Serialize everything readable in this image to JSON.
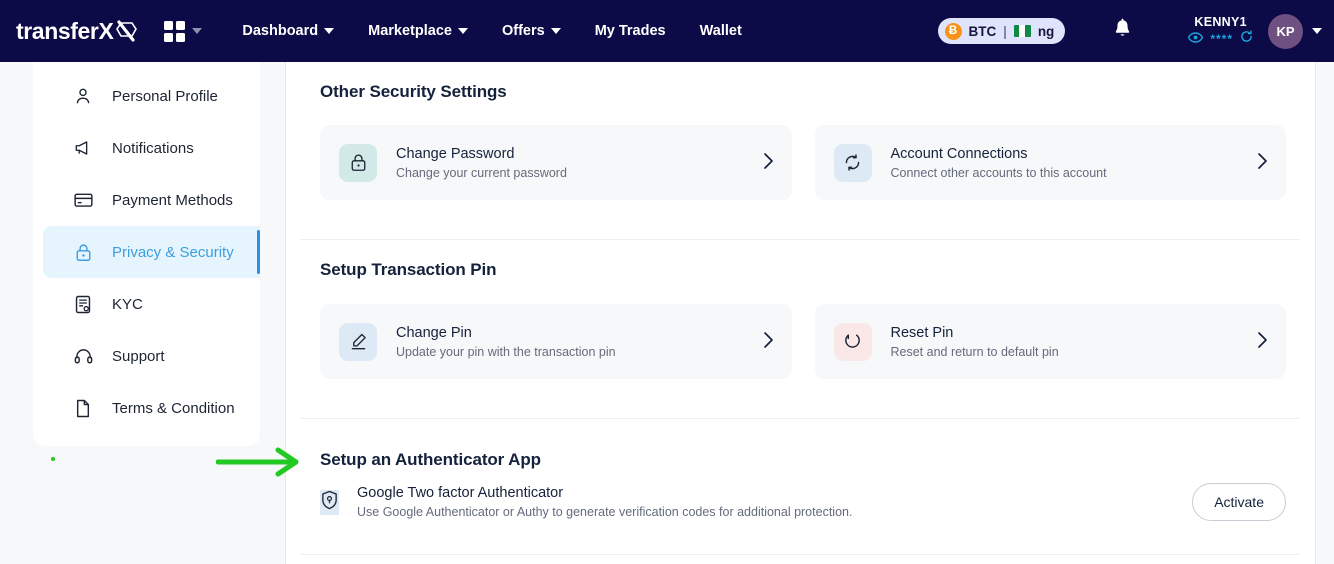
{
  "header": {
    "brand": "transferX",
    "brand_mark": "x-hex-logo",
    "apps_icon": "grid-apps-icon",
    "apps_caret": "chevron-down-icon",
    "nav": [
      {
        "label": "Dashboard",
        "has_caret": true
      },
      {
        "label": "Marketplace",
        "has_caret": true
      },
      {
        "label": "Offers",
        "has_caret": true
      },
      {
        "label": "My Trades",
        "has_caret": false
      },
      {
        "label": "Wallet",
        "has_caret": false
      }
    ],
    "currency_pill": {
      "crypto_symbol": "Ƀ",
      "crypto": "BTC",
      "divider": "|",
      "country": "ng",
      "flag": "nigeria-flag-icon"
    },
    "bell_icon": "notification-bell-icon",
    "user": {
      "name": "KENNY1",
      "eye_icon": "eye-visibility-icon",
      "balance_masked": "****",
      "refresh_icon": "refresh-icon",
      "avatar_initials": "KP",
      "avatar_caret": "chevron-down-icon"
    },
    "colors": {
      "bg": "#0c0a47",
      "pill_bg": "#dfe3fb",
      "btc_orange": "#f7931a",
      "avatar": "#6e5180",
      "accent_cyan": "#1ba7dd"
    }
  },
  "sidebar": {
    "items": [
      {
        "label": "Personal Profile",
        "icon": "user-icon",
        "active": false
      },
      {
        "label": "Notifications",
        "icon": "megaphone-icon",
        "active": false
      },
      {
        "label": "Payment Methods",
        "icon": "credit-card-icon",
        "active": false
      },
      {
        "label": "Privacy & Security",
        "icon": "lock-icon",
        "active": true
      },
      {
        "label": "KYC",
        "icon": "document-id-icon",
        "active": false
      },
      {
        "label": "Support",
        "icon": "headset-icon",
        "active": false
      },
      {
        "label": "Terms & Condition",
        "icon": "file-icon",
        "active": false
      }
    ],
    "active_color": "#3d9fe0",
    "active_bg": "#e6f4fd"
  },
  "main": {
    "security": {
      "title": "Other Security Settings",
      "cards": [
        {
          "title": "Change Password",
          "subtitle": "Change your current password",
          "icon": "padlock-icon",
          "icon_bg": "#d3e9e7",
          "chevron": "chevron-right-icon"
        },
        {
          "title": "Account Connections",
          "subtitle": "Connect other accounts to this account",
          "icon": "sync-circular-arrows-icon",
          "icon_bg": "#dde9f4",
          "chevron": "chevron-right-icon"
        }
      ]
    },
    "pin": {
      "title": "Setup Transaction Pin",
      "cards": [
        {
          "title": "Change Pin",
          "subtitle": "Update your pin with the transaction pin",
          "icon": "pencil-edit-icon",
          "icon_bg": "#dde9f4",
          "chevron": "chevron-right-icon"
        },
        {
          "title": "Reset Pin",
          "subtitle": "Reset and return to default pin",
          "icon": "reset-undo-arrow-icon",
          "icon_bg": "#fae8e8",
          "chevron": "chevron-right-icon"
        }
      ]
    },
    "authenticator": {
      "title": "Setup an Authenticator App",
      "item_title": "Google Two factor Authenticator",
      "item_subtitle": "Use Google Authenticator or Authy to generate verification codes for additional protection.",
      "icon": "shield-keyhole-icon",
      "icon_bg": "#dde9f4",
      "button_label": "Activate"
    }
  },
  "annotation": {
    "arrow": "green-pointer-arrow",
    "color": "#22c922"
  }
}
